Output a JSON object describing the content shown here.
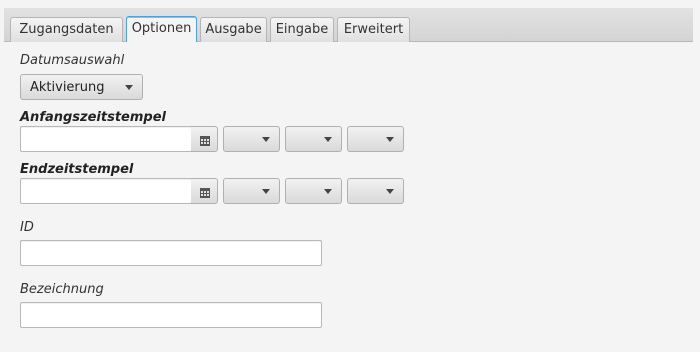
{
  "tabs": [
    {
      "label": "Zugangsdaten",
      "active": false
    },
    {
      "label": "Optionen",
      "active": true
    },
    {
      "label": "Ausgabe",
      "active": false
    },
    {
      "label": "Eingabe",
      "active": false
    },
    {
      "label": "Erweitert",
      "active": false
    }
  ],
  "form": {
    "datumsauswahl": {
      "label": "Datumsauswahl",
      "selected": "Aktivierung"
    },
    "anfang": {
      "label": "Anfangszeitstempel",
      "date_value": "",
      "hour": "",
      "minute": "",
      "second": ""
    },
    "ende": {
      "label": "Endzeitstempel",
      "date_value": "",
      "hour": "",
      "minute": "",
      "second": ""
    },
    "id": {
      "label": "ID",
      "value": ""
    },
    "bezeichnung": {
      "label": "Bezeichnung",
      "value": ""
    }
  },
  "icons": {
    "calendar": "calendar-icon",
    "dropdown": "chevron-down-icon"
  },
  "colors": {
    "active_tab_border": "#4aa3df",
    "background": "#f4f4f4"
  }
}
